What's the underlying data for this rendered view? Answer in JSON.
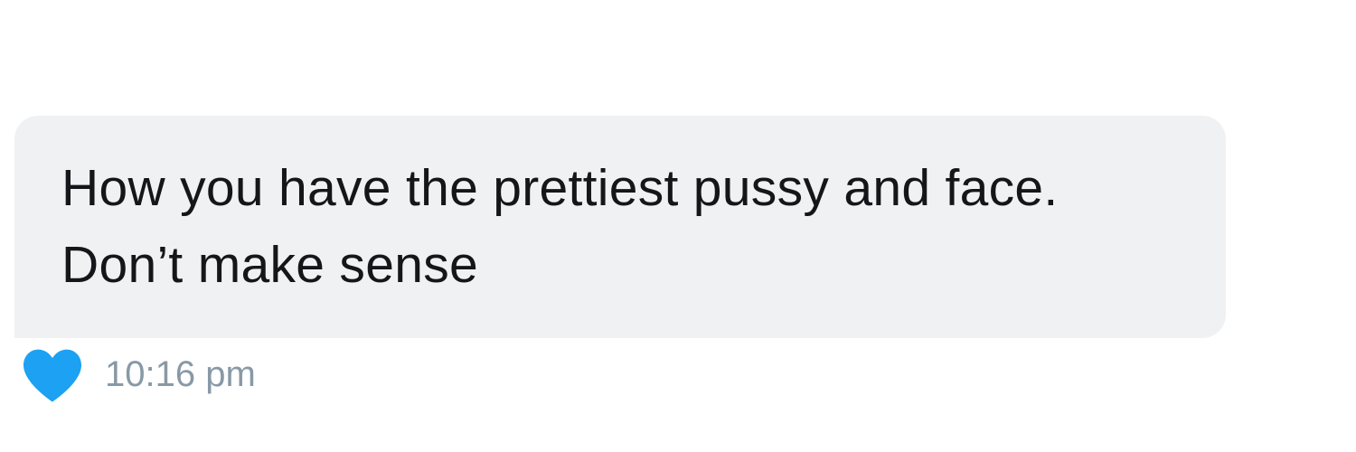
{
  "message": {
    "text": "How you have the prettiest pussy and face. Don’t make sense",
    "timestamp": "10:16 pm",
    "reaction_icon": "heart-icon",
    "reaction_color": "#1da1f2"
  },
  "colors": {
    "bubble_bg": "#f0f1f3",
    "text": "#14171a",
    "timestamp": "#8899a6"
  }
}
